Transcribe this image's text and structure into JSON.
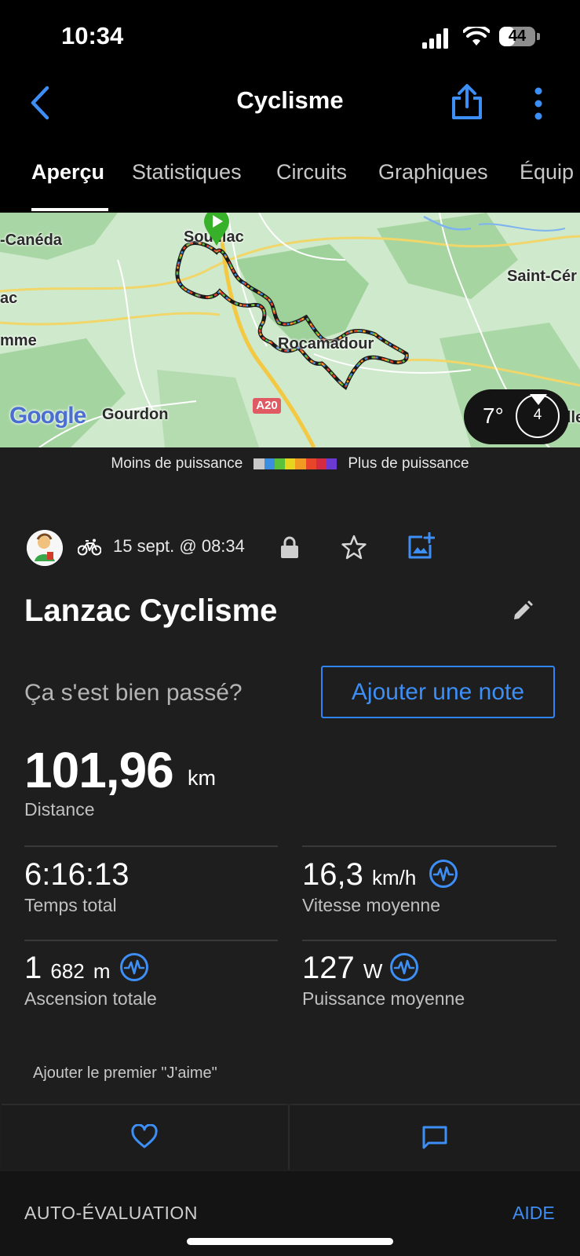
{
  "status_bar": {
    "time": "10:34",
    "battery": "44",
    "battery_level": 0.44
  },
  "header": {
    "title": "Cyclisme"
  },
  "tabs": [
    {
      "label": "Aperçu",
      "active": true
    },
    {
      "label": "Statistiques"
    },
    {
      "label": "Circuits"
    },
    {
      "label": "Graphiques"
    },
    {
      "label": "Équip"
    }
  ],
  "map": {
    "places": [
      "-Canéda",
      "Souillac",
      "ac",
      "mme",
      "Rocamadour",
      "Gourdon",
      "Saint-Cér",
      "lle"
    ],
    "road": "A20",
    "provider": "Google",
    "weather": {
      "temperature": "7°",
      "wind": "4"
    }
  },
  "power_legend": {
    "low_label": "Moins de puissance",
    "high_label": "Plus de puissance",
    "colors": [
      "#c8c8c8",
      "#3c8ee0",
      "#59c13a",
      "#e5d51f",
      "#f29b22",
      "#e8452a",
      "#d42a42",
      "#6b3ad2"
    ]
  },
  "activity": {
    "date": "15 sept. @ 08:34",
    "name": "Lanzac Cyclisme",
    "feeling_question": "Ça s'est bien passé?",
    "add_note": "Ajouter une note"
  },
  "distance": {
    "value": "101,96",
    "unit": "km",
    "label": "Distance"
  },
  "stats": {
    "total_time": {
      "value": "6:16:13",
      "label": "Temps total"
    },
    "avg_speed": {
      "value": "16,3",
      "unit": "km/h",
      "label": "Vitesse moyenne"
    },
    "ascent": {
      "value_big": "1",
      "value_small": "682",
      "unit": "m",
      "label": "Ascension totale"
    },
    "avg_power": {
      "value": "127",
      "unit": "W",
      "label": "Puissance moyenne"
    }
  },
  "social": {
    "first_like": "Ajouter le premier \"J'aime\""
  },
  "self_evaluation": {
    "title": "AUTO-ÉVALUATION",
    "help": "AIDE"
  },
  "colors": {
    "accent": "#3d8ef5",
    "start_marker": "#38b12a",
    "background": "#1e1e1e"
  }
}
